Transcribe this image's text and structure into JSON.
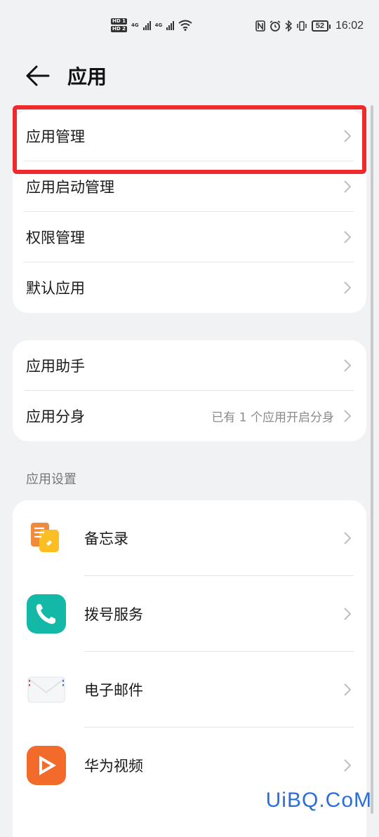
{
  "status_bar": {
    "hd1": "HD 1",
    "hd2": "HD 2",
    "net1": "4G",
    "net2": "4G",
    "battery": "52",
    "time": "16:02",
    "icons": [
      "nfc-icon",
      "alarm-icon",
      "bluetooth-icon",
      "vibrate-icon",
      "wifi-icon"
    ]
  },
  "header": {
    "title": "应用"
  },
  "card1": {
    "items": [
      {
        "label": "应用管理"
      },
      {
        "label": "应用启动管理"
      },
      {
        "label": "权限管理"
      },
      {
        "label": "默认应用"
      }
    ]
  },
  "card2": {
    "items": [
      {
        "label": "应用助手",
        "value": ""
      },
      {
        "label": "应用分身",
        "value": "已有 1 个应用开启分身"
      }
    ]
  },
  "section": {
    "label": "应用设置"
  },
  "apps": [
    {
      "label": "备忘录",
      "icon": "notepad-icon"
    },
    {
      "label": "拨号服务",
      "icon": "phone-icon"
    },
    {
      "label": "电子邮件",
      "icon": "envelope-icon"
    },
    {
      "label": "华为视频",
      "icon": "video-play-icon"
    }
  ],
  "watermark": "UiBQ.CoM",
  "colors": {
    "highlight": "#ee2a2d",
    "background": "#f1f2f4",
    "watermark": "#2b6fd6"
  }
}
